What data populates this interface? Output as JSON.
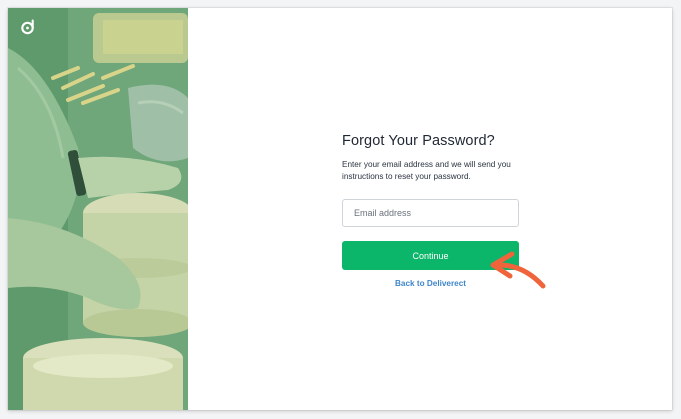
{
  "forgot_password": {
    "title": "Forgot Your Password?",
    "description_line1": "Enter your email address and we will send you",
    "description_line2": "instructions to reset your password.",
    "email_placeholder": "Email address",
    "email_value": "",
    "continue_label": "Continue",
    "back_link_label": "Back to Deliverect"
  },
  "icons": {
    "logo": "deliverect-logo-icon",
    "annotation": "arrow-annotation-icon"
  },
  "colors": {
    "brand_green": "#0bb56a",
    "link_blue": "#3f86c9",
    "annotation_orange": "#f0643c"
  }
}
